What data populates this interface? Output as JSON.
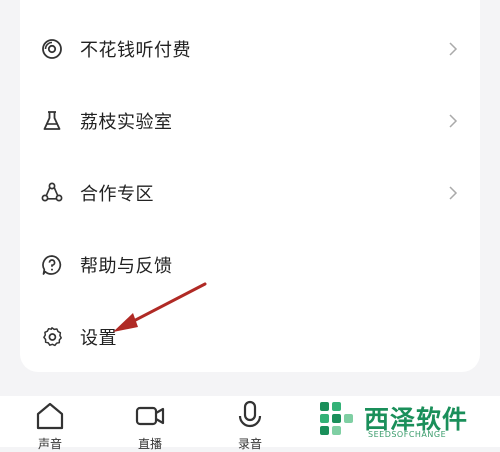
{
  "menu": {
    "items": [
      {
        "label": "不花钱听付费",
        "icon": "disc-icon",
        "has_chevron": true
      },
      {
        "label": "荔枝实验室",
        "icon": "flask-icon",
        "has_chevron": true
      },
      {
        "label": "合作专区",
        "icon": "collaboration-icon",
        "has_chevron": true
      },
      {
        "label": "帮助与反馈",
        "icon": "help-icon",
        "has_chevron": false
      },
      {
        "label": "设置",
        "icon": "gear-icon",
        "has_chevron": false
      }
    ]
  },
  "tabbar": {
    "tabs": [
      {
        "label": "声音",
        "icon": "home-icon"
      },
      {
        "label": "直播",
        "icon": "camera-icon"
      },
      {
        "label": "录音",
        "icon": "microphone-icon"
      }
    ]
  },
  "watermark": {
    "title": "西泽软件",
    "subtitle": "SEEDSOFCHANGE"
  },
  "colors": {
    "accent_arrow": "#b02a25",
    "watermark_green": "#1a8f5a",
    "background": "#f4f4f6"
  }
}
